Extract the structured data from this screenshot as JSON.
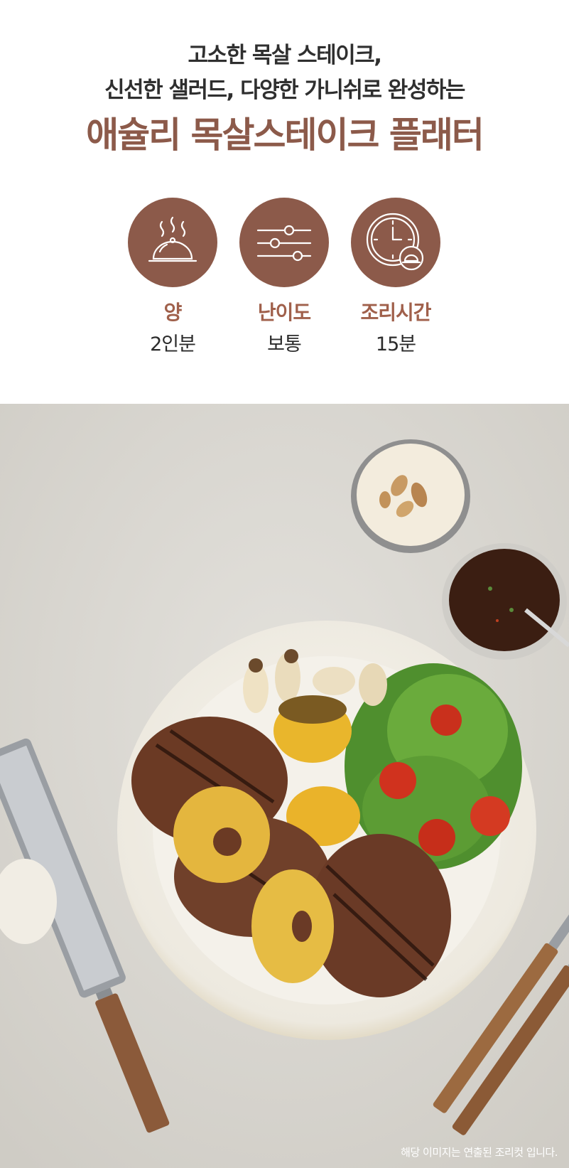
{
  "header": {
    "subtitle_line1": "고소한 목살 스테이크,",
    "subtitle_line2": "신선한 샐러드, 다양한 가니쉬로 완성하는",
    "title": "애슐리 목살스테이크 플래터"
  },
  "info": [
    {
      "icon": "cloche-icon",
      "label": "양",
      "value": "2인분"
    },
    {
      "icon": "sliders-icon",
      "label": "난이도",
      "value": "보통"
    },
    {
      "icon": "clock-icon",
      "label": "조리시간",
      "value": "15분"
    }
  ],
  "photo": {
    "caption": "해당 이미지는 연출된 조리컷 입니다."
  },
  "colors": {
    "accent": "#8c5a4a",
    "label": "#a0604b",
    "background": "#dcd9d3"
  }
}
